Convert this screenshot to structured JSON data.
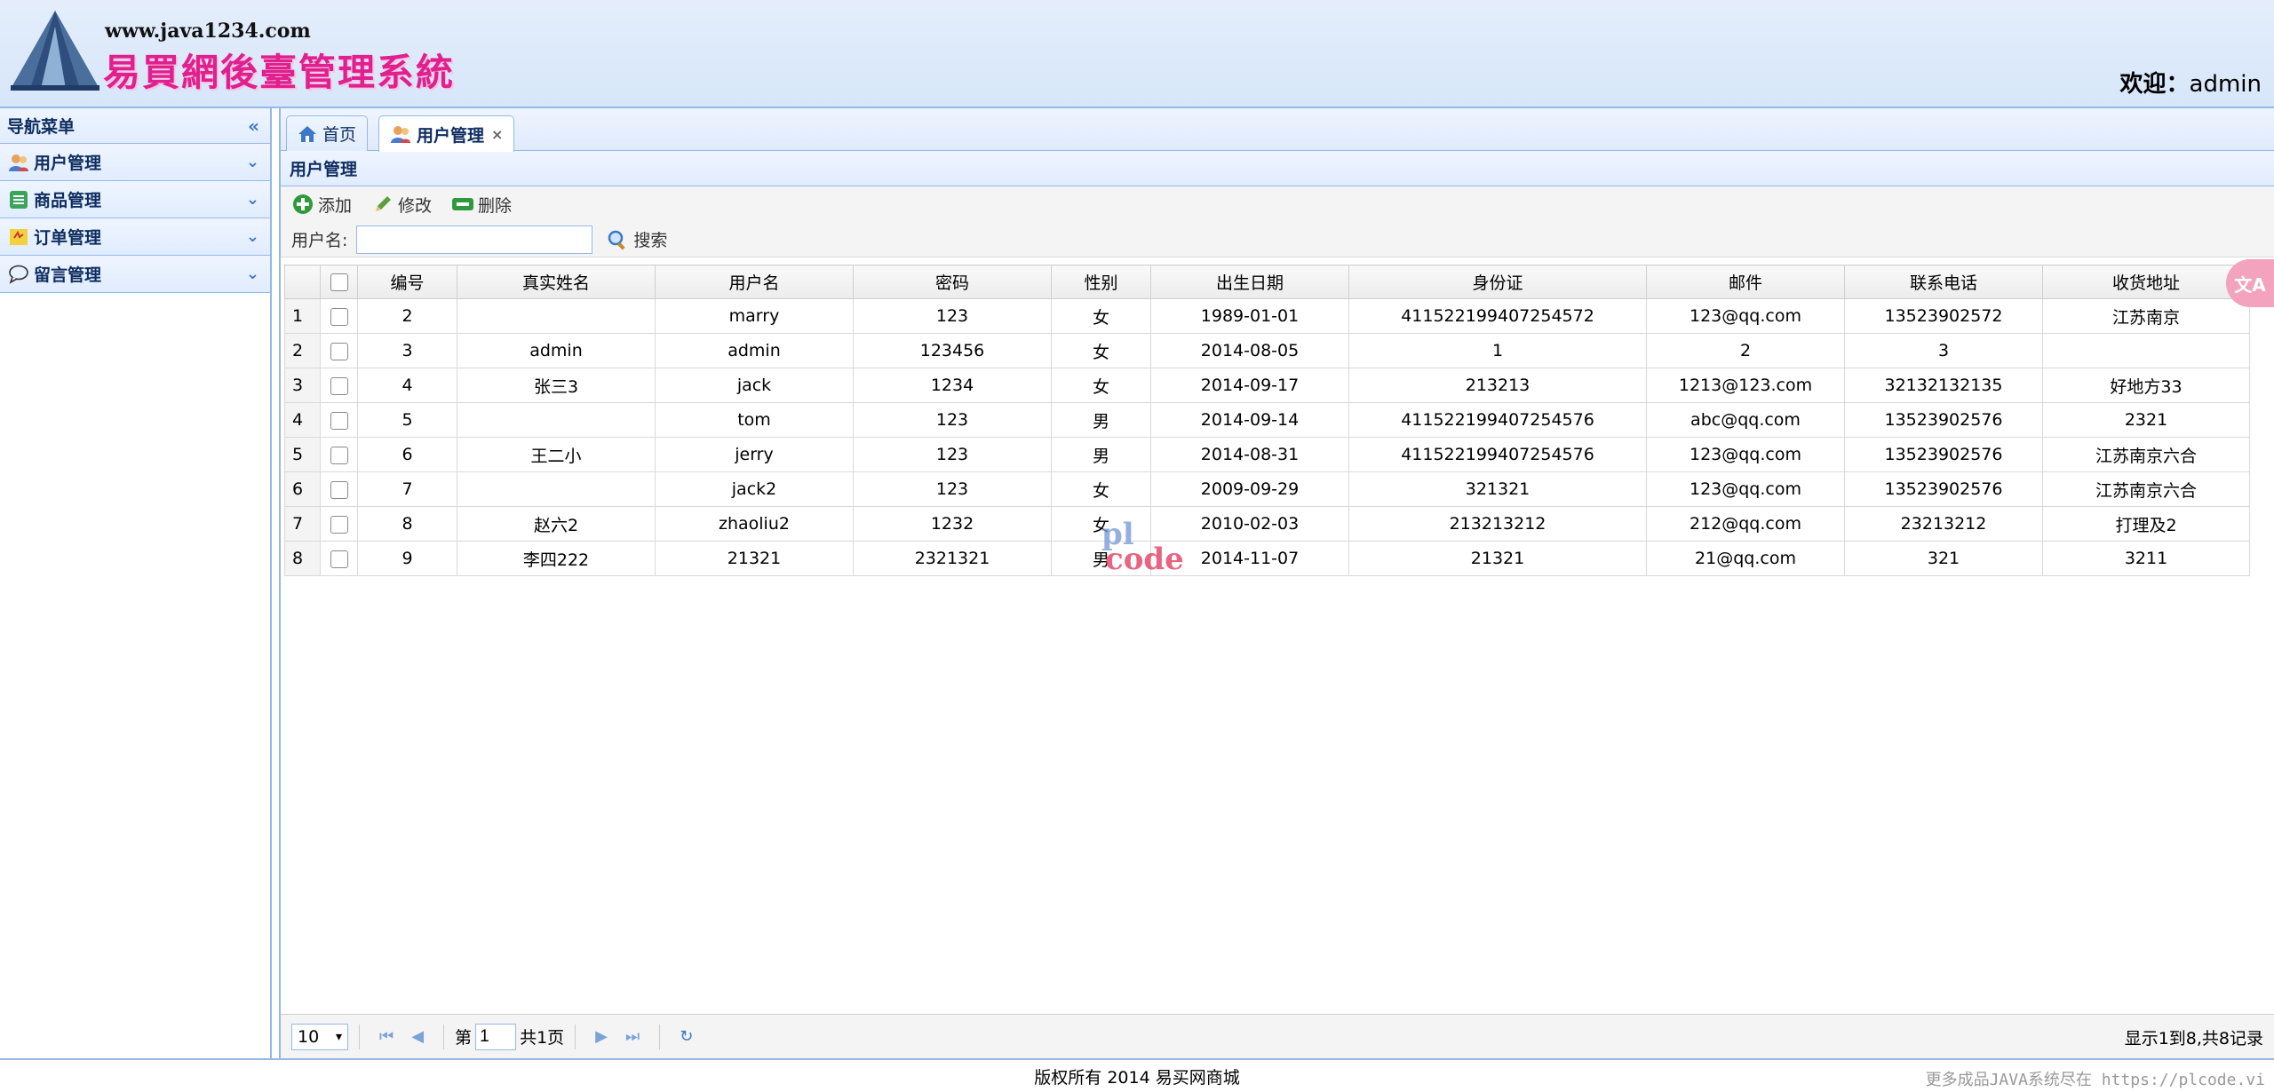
{
  "header": {
    "url": "www.java1234.com",
    "site_name": "易買網後臺管理系統",
    "welcome_label": "欢迎：",
    "username": "admin"
  },
  "sidebar": {
    "title": "导航菜单",
    "items": [
      {
        "label": "用户管理",
        "icon": "users-icon"
      },
      {
        "label": "商品管理",
        "icon": "list-icon"
      },
      {
        "label": "订单管理",
        "icon": "order-icon"
      },
      {
        "label": "留言管理",
        "icon": "comment-icon"
      }
    ]
  },
  "tabs": [
    {
      "label": "首页",
      "icon": "home-icon",
      "active": false
    },
    {
      "label": "用户管理",
      "icon": "users-icon",
      "active": true,
      "close": "×"
    }
  ],
  "panel": {
    "title": "用户管理",
    "toolbar": {
      "add": "添加",
      "edit": "修改",
      "delete": "删除"
    },
    "search": {
      "label": "用户名:",
      "value": "",
      "button": "搜索"
    }
  },
  "grid": {
    "columns": [
      "编号",
      "真实姓名",
      "用户名",
      "密码",
      "性别",
      "出生日期",
      "身份证",
      "邮件",
      "联系电话",
      "收货地址"
    ],
    "rows": [
      {
        "n": "1",
        "cells": [
          "2",
          "",
          "marry",
          "123",
          "女",
          "1989-01-01",
          "411522199407254572",
          "123@qq.com",
          "13523902572",
          "江苏南京"
        ]
      },
      {
        "n": "2",
        "cells": [
          "3",
          "admin",
          "admin",
          "123456",
          "女",
          "2014-08-05",
          "1",
          "2",
          "3",
          ""
        ]
      },
      {
        "n": "3",
        "cells": [
          "4",
          "张三3",
          "jack",
          "1234",
          "女",
          "2014-09-17",
          "213213",
          "1213@123.com",
          "32132132135",
          "好地方33"
        ]
      },
      {
        "n": "4",
        "cells": [
          "5",
          "",
          "tom",
          "123",
          "男",
          "2014-09-14",
          "411522199407254576",
          "abc@qq.com",
          "13523902576",
          "2321"
        ]
      },
      {
        "n": "5",
        "cells": [
          "6",
          "王二小",
          "jerry",
          "123",
          "男",
          "2014-08-31",
          "411522199407254576",
          "123@qq.com",
          "13523902576",
          "江苏南京六合"
        ]
      },
      {
        "n": "6",
        "cells": [
          "7",
          "",
          "jack2",
          "123",
          "女",
          "2009-09-29",
          "321321",
          "123@qq.com",
          "13523902576",
          "江苏南京六合"
        ]
      },
      {
        "n": "7",
        "cells": [
          "8",
          "赵六2",
          "zhaoliu2",
          "1232",
          "女",
          "2010-02-03",
          "213213212",
          "212@qq.com",
          "23213212",
          "打理及2"
        ]
      },
      {
        "n": "8",
        "cells": [
          "9",
          "李四222",
          "21321",
          "2321321",
          "男",
          "2014-11-07",
          "21321",
          "21@qq.com",
          "321",
          "3211"
        ]
      }
    ]
  },
  "pager": {
    "page_size": "10",
    "page_prefix": "第",
    "page_value": "1",
    "page_suffix": "共1页",
    "info": "显示1到8,共8记录"
  },
  "footer": {
    "copyright": "版权所有 2014 易买网商城",
    "ad": "更多成品JAVA系统尽在 https://plcode.vi"
  },
  "watermark": {
    "line1": "pl",
    "line2": "code"
  },
  "translate": {
    "label": "文A"
  },
  "colors": {
    "accent": "#95b8e7",
    "header_bg": "#d7e6fa",
    "brand_pink": "#e0208f"
  }
}
